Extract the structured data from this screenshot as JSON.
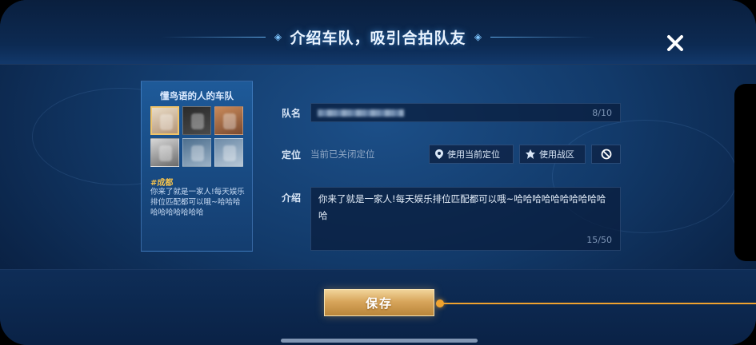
{
  "header": {
    "title": "介绍车队，吸引合拍队友",
    "close_icon": "close-icon"
  },
  "card": {
    "team_name": "懂鸟语的人的车队",
    "city": "#成都",
    "description": "你来了就是一家人!每天娱乐排位匹配都可以哦~哈哈哈哈哈哈哈哈哈哈",
    "avatars": [
      {
        "colors": [
          "#e9dcc7",
          "#b39375"
        ],
        "border": "#f0c46a"
      },
      {
        "colors": [
          "#2a2a2a",
          "#4a4a4a"
        ]
      },
      {
        "colors": [
          "#c98a5a",
          "#7a4a30"
        ]
      },
      {
        "colors": [
          "#d7d7d7",
          "#6a6a6a"
        ]
      },
      {
        "colors": [
          "#4d6f8e",
          "#9cb2c6"
        ]
      },
      {
        "colors": [
          "#6d8ba8",
          "#b7c7d6"
        ]
      }
    ]
  },
  "form": {
    "name": {
      "label": "队名",
      "counter": "8/10"
    },
    "location": {
      "label": "定位",
      "status": "当前已关闭定位",
      "use_current_label": "使用当前定位",
      "use_zone_label": "使用战区"
    },
    "intro": {
      "label": "介绍",
      "value": "你来了就是一家人!每天娱乐排位匹配都可以哦~哈哈哈哈哈哈哈哈哈哈哈",
      "counter": "15/50"
    }
  },
  "footer": {
    "save_label": "保存"
  },
  "colors": {
    "accent_gold": "#f0a22e",
    "panel_blue": "#123a6a",
    "city_tag": "#f2c14e"
  }
}
